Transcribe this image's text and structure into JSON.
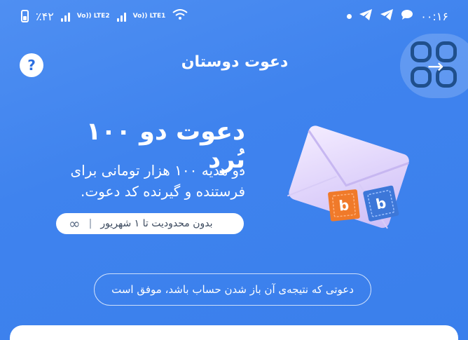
{
  "status_bar": {
    "battery": "٪۴۲",
    "sim2_label": "Vo)) LTE2",
    "sim1_label": "Vo)) LTE1",
    "time": "۰۰:۱۶"
  },
  "header": {
    "title": "دعوت دوستان",
    "help_label": "?",
    "back_label": "→"
  },
  "hero": {
    "title": "دعوت دو ۱۰۰ بُرد",
    "description_line1": "دو هدیه ۱۰۰ هزار تومانی برای",
    "description_line2": "فرستنده و گیرنده کد دعوت.",
    "limit_text": "بدون محدودیت تا ۱ شهریور",
    "limit_icon": "infinity-icon"
  },
  "note": {
    "text": "دعوتی که نتیجه‌ی آن باز شدن حساب باشد، موفق است"
  },
  "colors": {
    "background": "#3f83ee",
    "stamp_orange": "#f07a2a",
    "stamp_blue": "#3d77d8"
  }
}
